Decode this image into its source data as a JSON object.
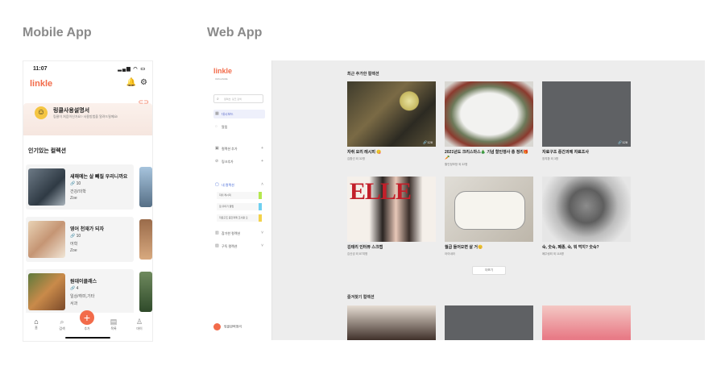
{
  "sections": {
    "mobile": "Mobile App",
    "web": "Web App"
  },
  "mobile": {
    "time": "11:07",
    "logo": "linkle",
    "banner": {
      "title": "링클사용설명서",
      "subtitle": "링클이 처음이신가요? 사용방법을 알려드릴께요!"
    },
    "popular_title": "인기있는 컬렉션",
    "cards": [
      {
        "title": "새해에는 살 빼질 우리니까요",
        "count": "10",
        "genre": "건강/의학",
        "user": "Zoe"
      },
      {
        "title": "영어 천재가 되자",
        "count": "10",
        "genre": "어학",
        "user": "Zoe"
      },
      {
        "title": "원데이클래스",
        "count": "4",
        "genre": "일상/취미,기타",
        "user": "서과"
      }
    ],
    "tabs": [
      "홈",
      "검색",
      "추가",
      "목록",
      "마이"
    ]
  },
  "web": {
    "logo": "linkle",
    "slogan": "ORGANIZE",
    "search_placeholder": "컬렉션, 링크 검색",
    "nav": {
      "dashboard": "대시보드",
      "alarm": "알림",
      "add_collection": "컬렉션 추가",
      "add_link": "링크추가",
      "my_collections": "내 컬렉션",
      "shared": "참가한 컬렉션",
      "subscribed": "구독 컬렉션"
    },
    "sub_items": [
      "자취 레시피",
      "집 꾸미기 꿀팁",
      "자료구조 중간과제 조사용 오"
    ],
    "user": "링클완벽정리",
    "recent_title": "최근 추가한 컬렉션",
    "tiles": [
      {
        "title": "자취 요리 레시피 😋",
        "sub": "김환선 외 32명",
        "count": "128"
      },
      {
        "title": "2021년도 크리스마스🎄 기념 할인행사 총 정리🎁🥕",
        "sub": "할인정보방 외 32명",
        "count": ""
      },
      {
        "title": "자료구조 중간과제 자료조사",
        "sub": "장지환 외 3명",
        "count": "128"
      },
      {
        "title": "김태리 인터뷰 스크랩",
        "sub": "김신성 외 87여명",
        "count": ""
      },
      {
        "title": "월급 들어오면 살 거😊",
        "sub": "아이네라",
        "count": ""
      },
      {
        "title": "숙, 숫숙, 폐종, 숙, 뭐 먹지? 숫숙?",
        "sub": "폐주링외 외 118명",
        "count": ""
      }
    ],
    "more_label": "더보기",
    "fav_title": "즐겨찾기 컬렉션",
    "elle_text": "ELLE"
  }
}
